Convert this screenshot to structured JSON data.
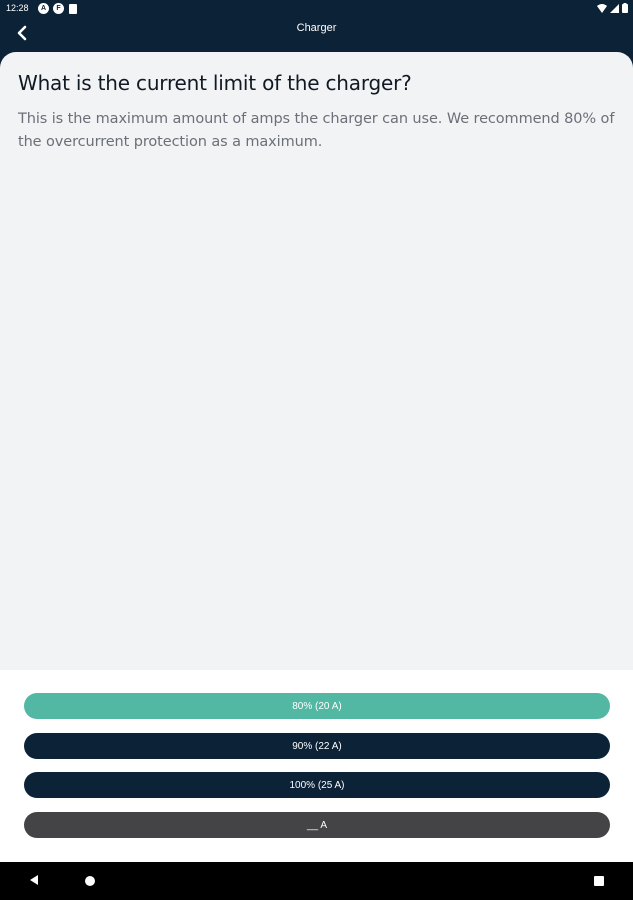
{
  "status_bar": {
    "time": "12:28",
    "left_icons": [
      "a-circle-icon",
      "f-circle-icon",
      "sim-card-icon"
    ],
    "left_icon_letters": [
      "A",
      "F"
    ],
    "right_icons": [
      "wifi-icon",
      "signal-icon",
      "battery-icon"
    ]
  },
  "app_bar": {
    "title": "Charger",
    "back_icon": "chevron-left-icon"
  },
  "question": {
    "title": "What is the current limit of the charger?",
    "description": "This is the maximum amount of amps the charger can use. We recommend 80% of the overcurrent protection as a maximum."
  },
  "options": [
    {
      "label": "80% (20 A)",
      "color": "#52b8a3"
    },
    {
      "label": "90% (22 A)",
      "color": "#0c2237"
    },
    {
      "label": "100% (25 A)",
      "color": "#0c2237"
    },
    {
      "label": "__ A",
      "color": "#444446"
    }
  ],
  "nav_bar": {
    "icons": [
      "back-triangle-icon",
      "home-circle-icon",
      "recents-square-icon"
    ]
  },
  "colors": {
    "primary_dark": "#0c2237",
    "accent": "#52b8a3",
    "content_background": "#f2f3f5"
  }
}
